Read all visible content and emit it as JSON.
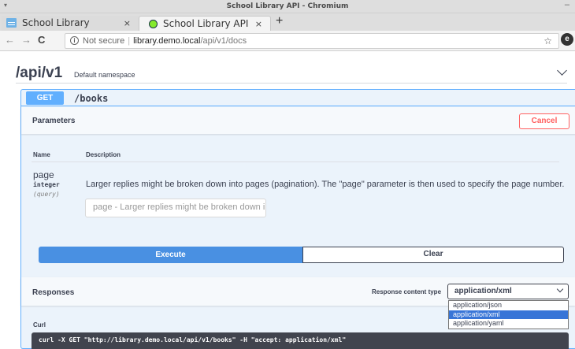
{
  "window": {
    "title": "School Library API - Chromium",
    "menu_glyph": "▾",
    "minimize_glyph": "–"
  },
  "tabs": [
    {
      "label": "School Library",
      "close": "×",
      "icon": "document-icon"
    },
    {
      "label": "School Library API",
      "close": "×",
      "icon": "swagger-icon"
    }
  ],
  "new_tab": "+",
  "address_bar": {
    "back": "←",
    "forward": "→",
    "reload": "C",
    "security_text": "Not secure",
    "separator": "|",
    "url_host": "library.demo.local",
    "url_path": "/api/v1/docs",
    "bookmark_star": "☆",
    "profile": "e"
  },
  "namespace": {
    "title": "/api/v1",
    "description": "Default namespace"
  },
  "operation": {
    "method": "GET",
    "path": "/books",
    "parameters_title": "Parameters",
    "cancel_label": "Cancel",
    "columns": {
      "name": "Name",
      "description": "Description"
    },
    "parameter": {
      "name": "page",
      "type": "integer",
      "in": "(query)",
      "description": "Larger replies might be broken down into pages (pagination). The \"page\" parameter is then used to specify the page number.",
      "placeholder": "page - Larger replies might be broken down into pages"
    },
    "execute_label": "Execute",
    "clear_label": "Clear",
    "responses_title": "Responses",
    "response_content_type_label": "Response content type",
    "content_type_selected": "application/xml",
    "content_type_options": [
      "application/json",
      "application/xml",
      "application/yaml"
    ],
    "curl_label": "Curl",
    "curl_command": "curl -X GET \"http://library.demo.local/api/v1/books\" -H \"accept: application/xml\""
  },
  "colors": {
    "get_accent": "#61affe",
    "execute_blue": "#4990e2",
    "cancel_red": "#ff6060",
    "selected_option": "#3875d7",
    "code_background": "#41444e"
  }
}
